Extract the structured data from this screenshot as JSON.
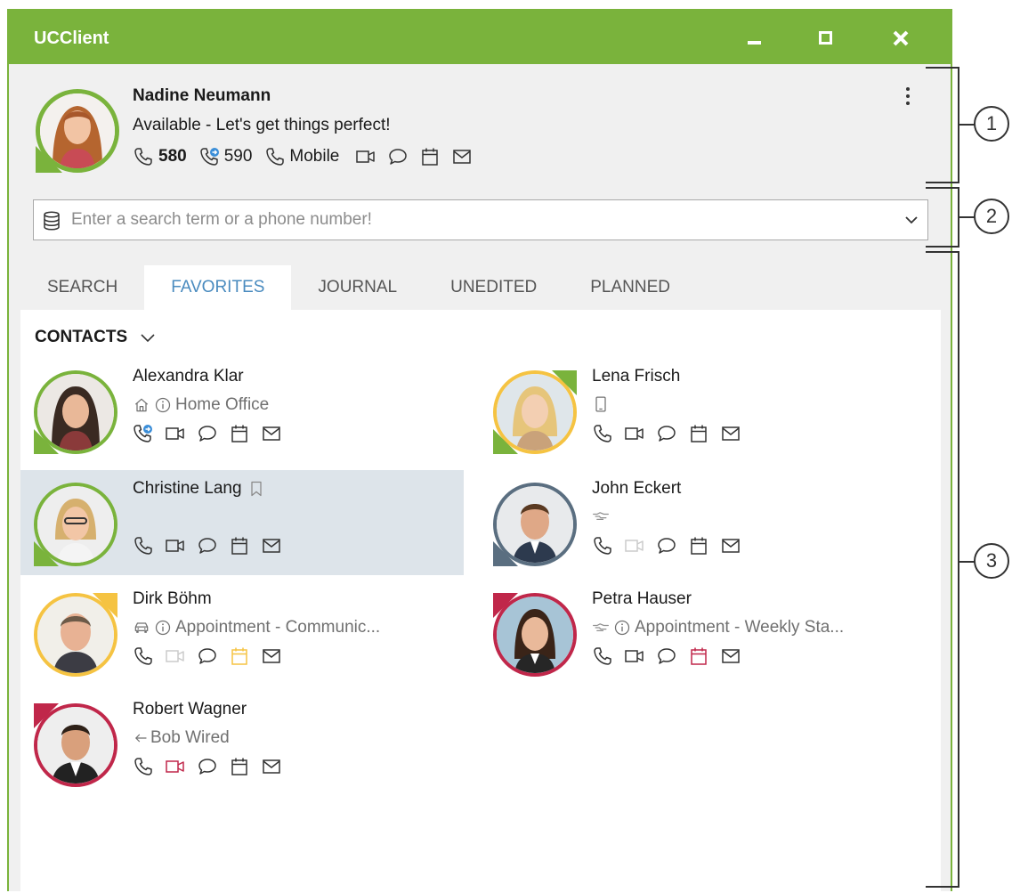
{
  "window": {
    "title": "UCClient"
  },
  "profile": {
    "name": "Nadine Neumann",
    "status": "Available - Let's get things perfect!",
    "ext_main": "580",
    "ext_second": "590",
    "mobile_label": "Mobile"
  },
  "search": {
    "placeholder": "Enter a search term or a phone number!"
  },
  "tabs": [
    "SEARCH",
    "FAVORITES",
    "JOURNAL",
    "UNEDITED",
    "PLANNED"
  ],
  "active_tab": "FAVORITES",
  "contacts_header": "CONTACTS",
  "contacts": [
    {
      "name": "Alexandra Klar",
      "status": "Home Office",
      "presence": "available"
    },
    {
      "name": "Lena Frisch",
      "status": "",
      "presence": "away-available"
    },
    {
      "name": "Christine Lang",
      "status": "",
      "presence": "available",
      "selected": true
    },
    {
      "name": "John Eckert",
      "status": "",
      "presence": "offline"
    },
    {
      "name": "Dirk Böhm",
      "status": "Appointment - Communic...",
      "presence": "away"
    },
    {
      "name": "Petra Hauser",
      "status": "Appointment - Weekly Sta...",
      "presence": "busy"
    },
    {
      "name": "Robert Wagner",
      "status": "Bob Wired",
      "presence": "busy"
    }
  ],
  "callouts": [
    "1",
    "2",
    "3"
  ],
  "colors": {
    "accent_green": "#7ab33c",
    "tab_active": "#4a8bbf",
    "away_yellow": "#f5c342",
    "busy_red": "#c0274a",
    "offline_slate": "#5a6e80",
    "selected_row": "#dde4ea"
  }
}
